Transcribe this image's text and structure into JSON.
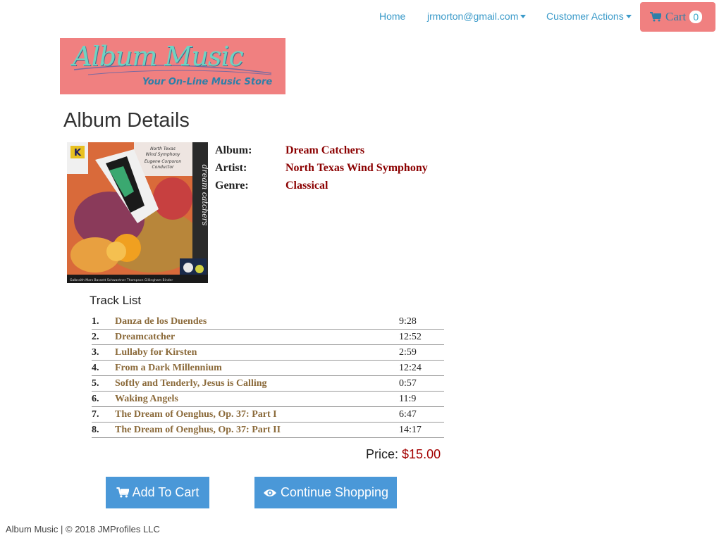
{
  "nav": {
    "home_label": "Home",
    "user_label": "jrmorton@gmail.com",
    "actions_label": "Customer Actions",
    "cart_label": "Cart",
    "cart_count": "0"
  },
  "logo": {
    "title": "Album Music",
    "subtitle": "Your On-Line Music Store"
  },
  "page": {
    "title": "Album Details"
  },
  "album": {
    "album_label": "Album:",
    "album_value": "Dream Catchers",
    "artist_label": "Artist:",
    "artist_value": "North Texas Wind Symphony",
    "genre_label": "Genre:",
    "genre_value": "Classical",
    "cover_text_1": "North Texas",
    "cover_text_2": "Wind Symphony",
    "cover_text_3": "Eugene Corporon",
    "cover_text_4": "Conductor",
    "cover_spine": "dream catchers",
    "cover_footer": "Galbraith Mars Bassett Schwantner Thompson Gillingham Binder"
  },
  "tracks": {
    "title": "Track List",
    "items": [
      {
        "num": "1.",
        "name": "Danza de los Duendes",
        "duration": "9:28"
      },
      {
        "num": "2.",
        "name": "Dreamcatcher",
        "duration": "12:52"
      },
      {
        "num": "3.",
        "name": "Lullaby for Kirsten",
        "duration": "2:59"
      },
      {
        "num": "4.",
        "name": "From a Dark Millennium",
        "duration": "12:24"
      },
      {
        "num": "5.",
        "name": "Softly and Tenderly, Jesus is Calling",
        "duration": "0:57"
      },
      {
        "num": "6.",
        "name": "Waking Angels",
        "duration": "11:9"
      },
      {
        "num": "7.",
        "name": "The Dream of Oenghus, Op. 37: Part I",
        "duration": "6:47"
      },
      {
        "num": "8.",
        "name": "The Dream of Oenghus, Op. 37: Part II",
        "duration": "14:17"
      }
    ]
  },
  "price": {
    "label": "Price:",
    "value": "$15.00"
  },
  "buttons": {
    "add_to_cart": "Add To Cart",
    "continue_shopping": "Continue Shopping"
  },
  "footer": {
    "text": "Album Music | © 2018 JMProfiles LLC"
  },
  "colors": {
    "brand_pink": "#f08080",
    "link_blue": "#3a9ac9",
    "button_blue": "#4a98d8",
    "value_red": "#8b0000"
  }
}
